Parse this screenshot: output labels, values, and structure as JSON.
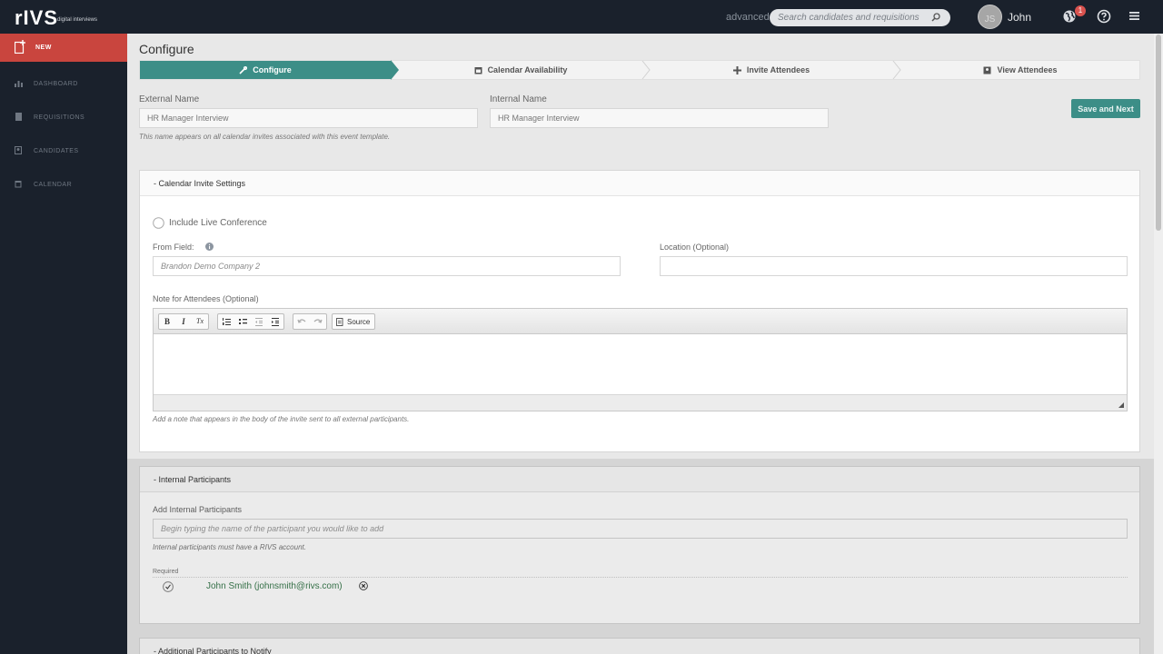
{
  "header": {
    "logo_text": "rIVS",
    "logo_sub": "digital interviews",
    "advanced_label": "advanced",
    "search_placeholder": "Search candidates and requisitions",
    "avatar_initials": "JS",
    "username": "John",
    "notification_count": "1",
    "icons": [
      "search-icon",
      "globe-icon",
      "help-icon",
      "hamburger-menu-icon"
    ]
  },
  "sidebar": {
    "new_label": "NEW",
    "items": [
      {
        "label": "DASHBOARD",
        "icon": "bar-chart-icon"
      },
      {
        "label": "REQUISITIONS",
        "icon": "document-icon"
      },
      {
        "label": "CANDIDATES",
        "icon": "person-card-icon"
      },
      {
        "label": "CALENDAR",
        "icon": "calendar-icon"
      }
    ]
  },
  "page": {
    "title": "Configure"
  },
  "wizard": {
    "steps": [
      {
        "label": "Configure",
        "icon": "wrench-icon",
        "active": true
      },
      {
        "label": "Calendar Availability",
        "icon": "calendar-icon"
      },
      {
        "label": "Invite Attendees",
        "icon": "plus-icon"
      },
      {
        "label": "View Attendees",
        "icon": "person-icon"
      }
    ]
  },
  "form": {
    "external_label": "External Name",
    "external_value": "HR Manager Interview",
    "external_hint": "This name appears on all calendar invites associated with this event template.",
    "internal_label": "Internal Name",
    "internal_value": "HR Manager Interview",
    "save_label": "Save and Next"
  },
  "calendar_panel": {
    "title": "- Calendar Invite Settings",
    "live_conf_label": "Include Live Conference",
    "from_label": "From Field:",
    "from_placeholder": "Brandon Demo Company 2",
    "location_label": "Location (Optional)",
    "note_label": "Note for Attendees (Optional)",
    "toolbar": {
      "bold": "B",
      "italic": "I",
      "clear": "Tx",
      "source_label": "Source"
    },
    "note_hint": "Add a note that appears in the body of the invite sent to all external participants."
  },
  "internal_panel": {
    "title": "- Internal Participants",
    "add_label": "Add Internal Participants",
    "add_placeholder": "Begin typing the name of the participant you would like to add",
    "add_hint": "Internal participants must have a RIVS account.",
    "required_label": "Required",
    "participant": "John Smith (johnsmith@rivs.com)"
  },
  "additional_panel": {
    "title": "- Additional Participants to Notify"
  },
  "colors": {
    "dark_bg": "#1a212c",
    "accent_teal": "#3c8e87",
    "new_red": "#c9453e",
    "badge_red": "#d9534f",
    "participant_green": "#3a7a4e"
  }
}
